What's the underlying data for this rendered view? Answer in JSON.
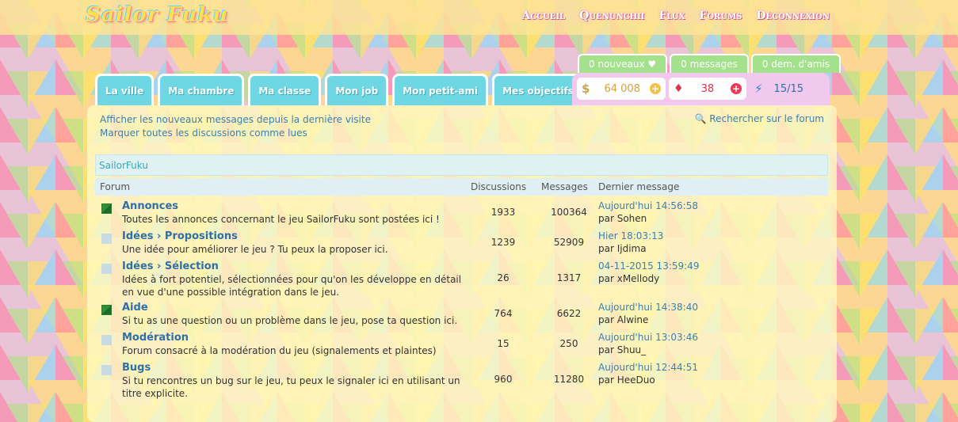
{
  "logo": "Sailor Fuku",
  "nav": [
    "Accueil",
    "Quenunchii",
    "Flux",
    "Forums",
    "Déconnexion"
  ],
  "tabs": [
    "La ville",
    "Ma chambre",
    "Ma classe",
    "Mon job",
    "Mon petit-ami",
    "Mes objectifs"
  ],
  "notifs": {
    "new": "0 nouveaux ♥",
    "messages": "0 messages",
    "friends": "0 dem. d'amis"
  },
  "stats": {
    "money": "64 008",
    "gems": "38",
    "energy": "15/15"
  },
  "links": {
    "new_messages": "Afficher les nouveaux messages depuis la dernière visite",
    "mark_read": "Marquer toutes les discussions comme lues",
    "search": "Rechercher sur le forum"
  },
  "breadcrumb": "SailorFuku",
  "columns": {
    "forum": "Forum",
    "discussions": "Discussions",
    "messages": "Messages",
    "last": "Dernier message"
  },
  "forums": [
    {
      "name": "Annonces",
      "desc": "Toutes les annonces concernant le jeu SailorFuku sont postées ici !",
      "discussions": "1933",
      "messages": "100364",
      "last_date": "Aujourd'hui 14:56:58",
      "last_by": "par Sohen"
    },
    {
      "name": "Idées › Propositions",
      "desc": "Une idée pour améliorer le jeu ? Tu peux la proposer ici.",
      "discussions": "1239",
      "messages": "52909",
      "last_date": "Hier 18:03:13",
      "last_by": "par Ijdima"
    },
    {
      "name": "Idées › Sélection",
      "desc": "Idées à fort potentiel, sélectionnées pour qu'on les développe en détail en vue d'une possible intégration dans le jeu.",
      "discussions": "26",
      "messages": "1317",
      "last_date": "04-11-2015 13:59:49",
      "last_by": "par xMellody"
    },
    {
      "name": "Aide",
      "desc": "Si tu as une question ou un problème dans le jeu, pose ta question ici.",
      "discussions": "764",
      "messages": "6622",
      "last_date": "Aujourd'hui 14:38:40",
      "last_by": "par Alwine"
    },
    {
      "name": "Modération",
      "desc": "Forum consacré à la modération du jeu (signalements et plaintes)",
      "discussions": "15",
      "messages": "250",
      "last_date": "Aujourd'hui 13:03:46",
      "last_by": "par Shuu_"
    },
    {
      "name": "Bugs",
      "desc": "Si tu rencontres un bug sur le jeu, tu peux le signaler ici en utilisant un titre explicite.",
      "discussions": "960",
      "messages": "11280",
      "last_date": "Aujourd'hui 12:44:51",
      "last_by": "par HeeDuo"
    }
  ]
}
